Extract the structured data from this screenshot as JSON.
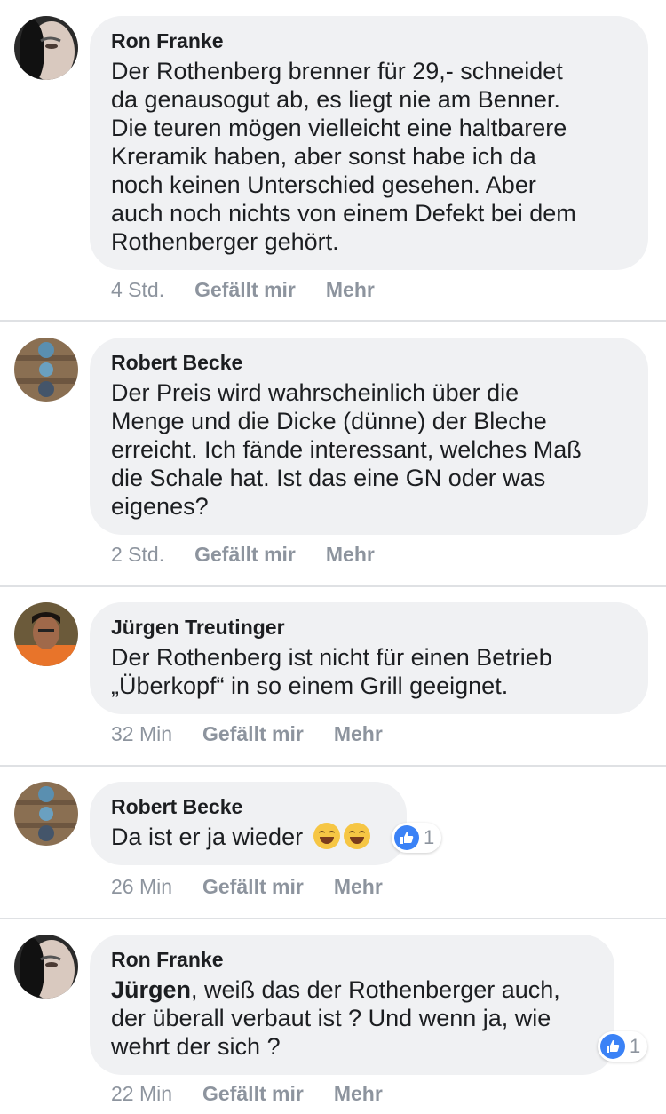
{
  "comments": [
    {
      "author": "Ron Franke",
      "text": "Der Rothenberg brenner für 29,- schneidet\nda genausogut ab, es liegt nie am Benner.\nDie teuren mögen vielleicht eine haltbarere\nKreramik haben, aber sonst habe ich da\nnoch keinen Unterschied gesehen. Aber\nauch noch nichts von einem Defekt bei dem\nRothenberger gehört.",
      "time": "4 Std.",
      "like_label": "Gefällt mir",
      "more_label": "Mehr"
    },
    {
      "author": "Robert Becke",
      "text": "Der Preis wird wahrscheinlich über die\nMenge und die Dicke (dünne) der Bleche\nerreicht. Ich fände interessant, welches Maß\ndie Schale hat. Ist das eine GN oder was\neigenes?",
      "time": "2 Std.",
      "like_label": "Gefällt mir",
      "more_label": "Mehr"
    },
    {
      "author": "Jürgen Treutinger",
      "text": "Der Rothenberg ist nicht für einen Betrieb\n„Überkopf“ in so einem Grill geeignet.",
      "time": "32 Min",
      "like_label": "Gefällt mir",
      "more_label": "Mehr"
    },
    {
      "author": "Robert Becke",
      "text": "Da ist er ja wieder",
      "emojis": [
        "laughing-tears-emoji",
        "laughing-tears-emoji"
      ],
      "reaction_count": "1",
      "time": "26 Min",
      "like_label": "Gefällt mir",
      "more_label": "Mehr"
    },
    {
      "author": "Ron Franke",
      "mention": "Jürgen",
      "text": ", weiß das der Rothenberger auch,\nder überall verbaut ist ? Und wenn ja, wie\nwehrt der sich ?",
      "reaction_count": "1",
      "time": "22 Min",
      "like_label": "Gefällt mir",
      "more_label": "Mehr"
    }
  ],
  "colors": {
    "bubble": "#f0f1f3",
    "meta_text": "#8d949e",
    "like_reaction": "#3b82f6"
  }
}
